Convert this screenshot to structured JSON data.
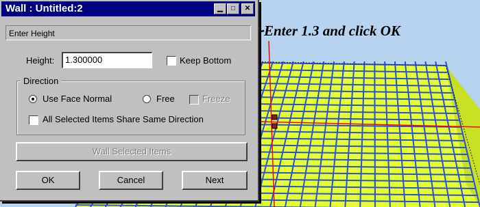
{
  "window": {
    "title": "Wall : Untitled:2",
    "prompt": "Enter Height"
  },
  "height_field": {
    "label": "Height:",
    "value": "1.300000"
  },
  "keep_bottom": {
    "label": "Keep Bottom",
    "checked": false
  },
  "direction": {
    "group_label": "Direction",
    "use_face_normal": {
      "label": "Use Face Normal",
      "selected": true
    },
    "free": {
      "label": "Free",
      "selected": false
    },
    "freeze": {
      "label": "Freeze",
      "checked": false,
      "enabled": false
    },
    "share_direction": {
      "label": "All Selected Items Share Same Direction",
      "checked": false
    }
  },
  "buttons": {
    "wall_selected": {
      "label": "Wall Selected Items",
      "enabled": false
    },
    "ok": "OK",
    "cancel": "Cancel",
    "next": "Next"
  },
  "annotation": "Enter 1.3 and click OK",
  "colors": {
    "title_bar": "#000080",
    "dialog_face": "#c0c0c0",
    "viewport_background": "#b7d3ee",
    "grid_surface": "#e5ff2e",
    "grid_lines": "#2b4fd6",
    "axis_lines": "#ff0000"
  }
}
